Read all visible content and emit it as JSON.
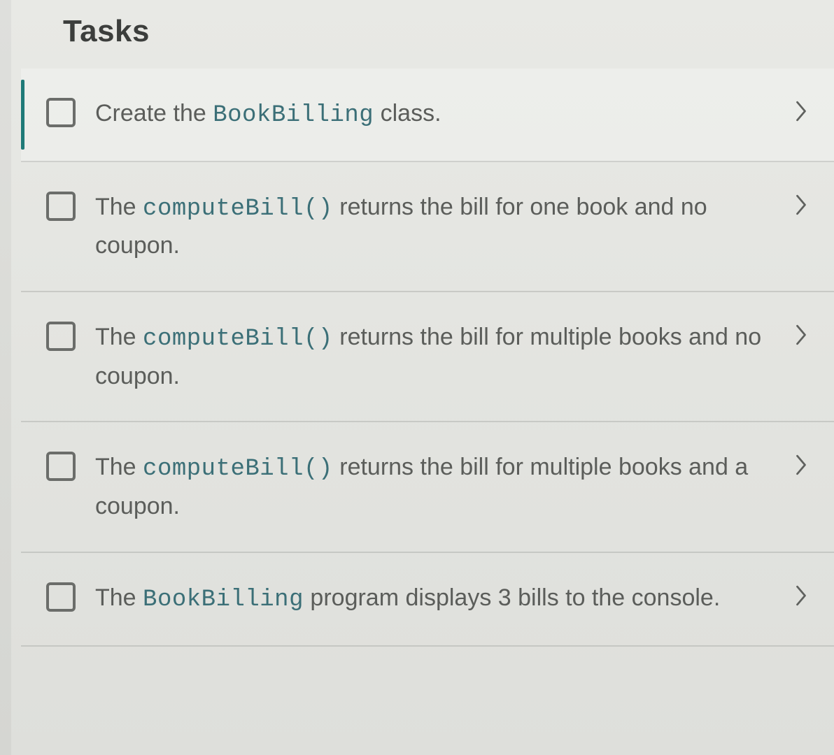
{
  "header": {
    "title": "Tasks"
  },
  "tasks": [
    {
      "checked": false,
      "selected": true,
      "segments": [
        {
          "text": "Create the ",
          "code": false
        },
        {
          "text": "BookBilling",
          "code": true
        },
        {
          "text": " class.",
          "code": false
        }
      ]
    },
    {
      "checked": false,
      "selected": false,
      "segments": [
        {
          "text": "The ",
          "code": false
        },
        {
          "text": "computeBill()",
          "code": true
        },
        {
          "text": " returns the bill for one book and no coupon.",
          "code": false
        }
      ]
    },
    {
      "checked": false,
      "selected": false,
      "segments": [
        {
          "text": "The ",
          "code": false
        },
        {
          "text": "computeBill()",
          "code": true
        },
        {
          "text": " returns the bill for multiple books and no coupon.",
          "code": false
        }
      ]
    },
    {
      "checked": false,
      "selected": false,
      "segments": [
        {
          "text": "The ",
          "code": false
        },
        {
          "text": "computeBill()",
          "code": true
        },
        {
          "text": " returns the bill for multiple books and a coupon.",
          "code": false
        }
      ]
    },
    {
      "checked": false,
      "selected": false,
      "segments": [
        {
          "text": "The ",
          "code": false
        },
        {
          "text": "BookBilling",
          "code": true
        },
        {
          "text": " program displays 3 bills to the console.",
          "code": false
        }
      ]
    }
  ]
}
